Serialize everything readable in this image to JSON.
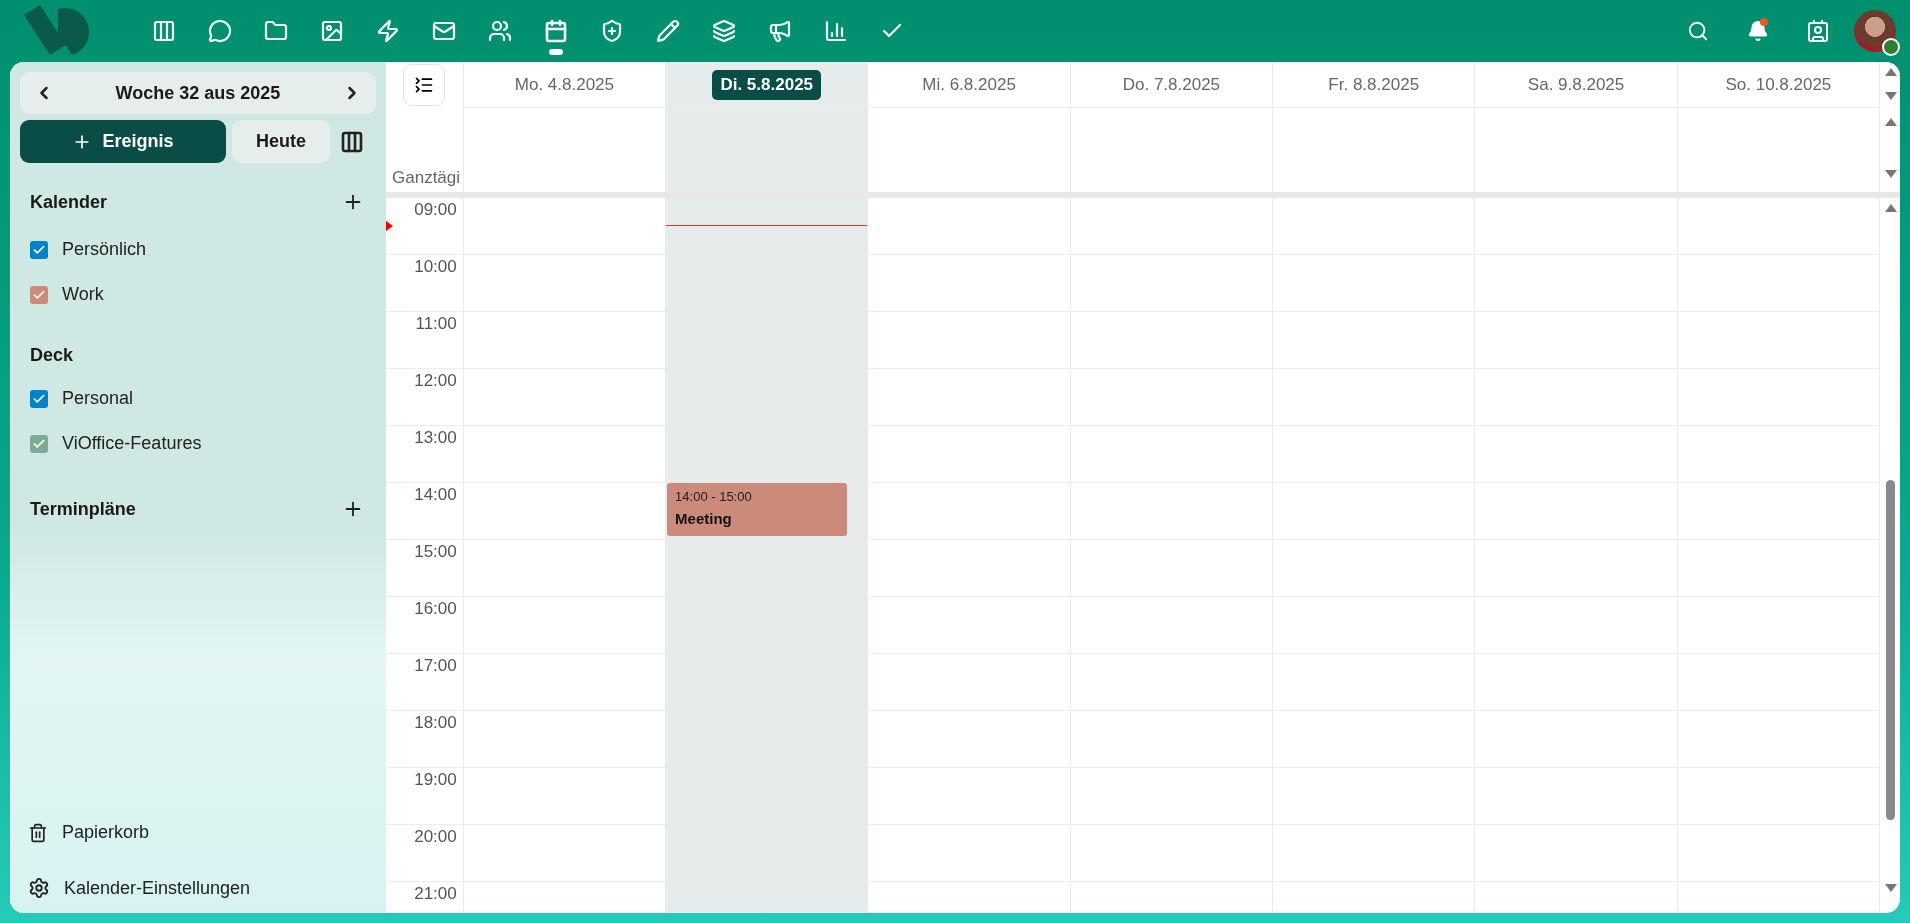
{
  "topbar": {
    "apps": [
      {
        "selected": false
      },
      {
        "selected": false
      },
      {
        "selected": false
      },
      {
        "selected": false
      },
      {
        "selected": false
      },
      {
        "selected": false
      },
      {
        "selected": false
      },
      {
        "selected": true
      },
      {
        "selected": false
      },
      {
        "selected": false
      },
      {
        "selected": false
      },
      {
        "selected": false
      },
      {
        "selected": false
      },
      {
        "selected": false
      }
    ],
    "notifications_unread": true,
    "user_online": true
  },
  "sidebar": {
    "week_title": "Woche 32 aus 2025",
    "new_event_button": "Ereignis",
    "today_button": "Heute",
    "sections": [
      {
        "title": "Kalender",
        "addable": true,
        "items": [
          {
            "label": "Persönlich",
            "checked": true,
            "color": "#0082c9"
          },
          {
            "label": "Work",
            "checked": true,
            "color": "#cc8a7a"
          }
        ]
      },
      {
        "title": "Deck",
        "addable": false,
        "items": [
          {
            "label": "Personal",
            "checked": true,
            "color": "#0082c9"
          },
          {
            "label": "ViOffice-Features",
            "checked": true,
            "color": "#7aab94"
          }
        ]
      },
      {
        "title": "Terminpläne",
        "addable": true
      }
    ],
    "trash": "Papierkorb",
    "settings": "Kalender-Einstellungen"
  },
  "calendar": {
    "allday_label": "Ganztägi",
    "days": [
      {
        "label": "Mo. 4.8.2025",
        "selected": false
      },
      {
        "label": "Di. 5.8.2025",
        "selected": true,
        "events": [
          {
            "time": "14:00 - 15:00",
            "title": "Meeting",
            "color": "#cc8a7a"
          }
        ]
      },
      {
        "label": "Mi. 6.8.2025",
        "selected": false
      },
      {
        "label": "Do. 7.8.2025",
        "selected": false
      },
      {
        "label": "Fr. 8.8.2025",
        "selected": false
      },
      {
        "label": "Sa. 9.8.2025",
        "selected": false
      },
      {
        "label": "So. 10.8.2025",
        "selected": false
      }
    ],
    "hours": [
      "09:00",
      "10:00",
      "11:00",
      "12:00",
      "13:00",
      "14:00",
      "15:00",
      "16:00",
      "17:00",
      "18:00",
      "19:00",
      "20:00",
      "21:00"
    ]
  }
}
